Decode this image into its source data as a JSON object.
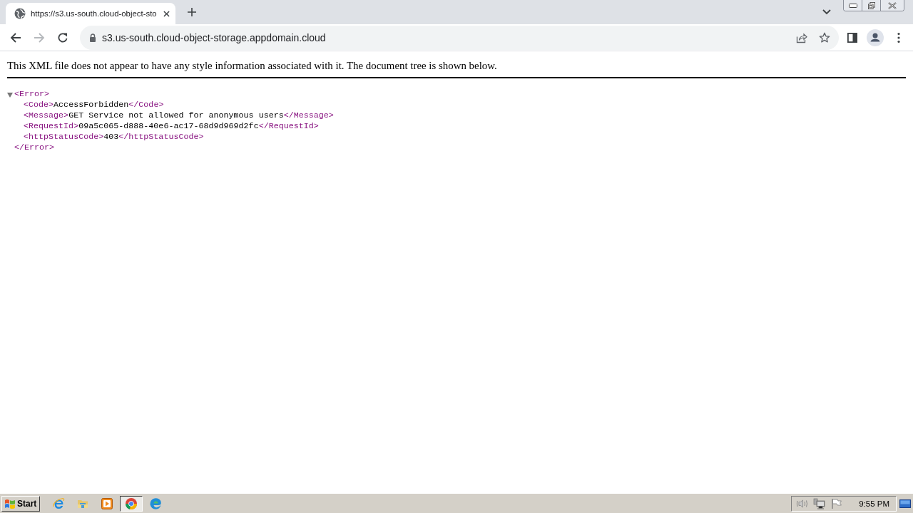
{
  "browser": {
    "tabs": [
      {
        "title": "https://s3.us-south.cloud-object-sto",
        "selected": true
      }
    ],
    "nav_buttons": [
      {
        "kind": "back",
        "disabled": false
      },
      {
        "kind": "forward",
        "disabled": true
      },
      {
        "kind": "reload",
        "disabled": false
      }
    ],
    "address": "s3.us-south.cloud-object-storage.appdomain.cloud"
  },
  "page": {
    "notice": "This XML file does not appear to have any style information associated with it. The document tree is shown below.",
    "xml_tree": {
      "open_tag": "<Error>",
      "close_tag": "</Error>",
      "expanded": true,
      "children": [
        {
          "open_tag": "<Code>",
          "value": "AccessForbidden",
          "close_tag": "</Code>"
        },
        {
          "open_tag": "<Message>",
          "value": "GET Service not allowed for anonymous users",
          "close_tag": "</Message>"
        },
        {
          "open_tag": "<RequestId>",
          "value": "09a5c065-d888-40e6-ac17-68d9d969d2fc",
          "close_tag": "</RequestId>"
        },
        {
          "open_tag": "<httpStatusCode>",
          "value": "403",
          "close_tag": "</httpStatusCode>"
        }
      ]
    }
  },
  "taskbar": {
    "start_label": "Start",
    "apps": [
      {
        "kind": "ie",
        "selected": false
      },
      {
        "kind": "folder",
        "selected": false
      },
      {
        "kind": "media",
        "selected": false
      },
      {
        "kind": "chrome",
        "selected": true
      },
      {
        "kind": "edge",
        "selected": false
      }
    ],
    "clock": "9:55 PM"
  }
}
